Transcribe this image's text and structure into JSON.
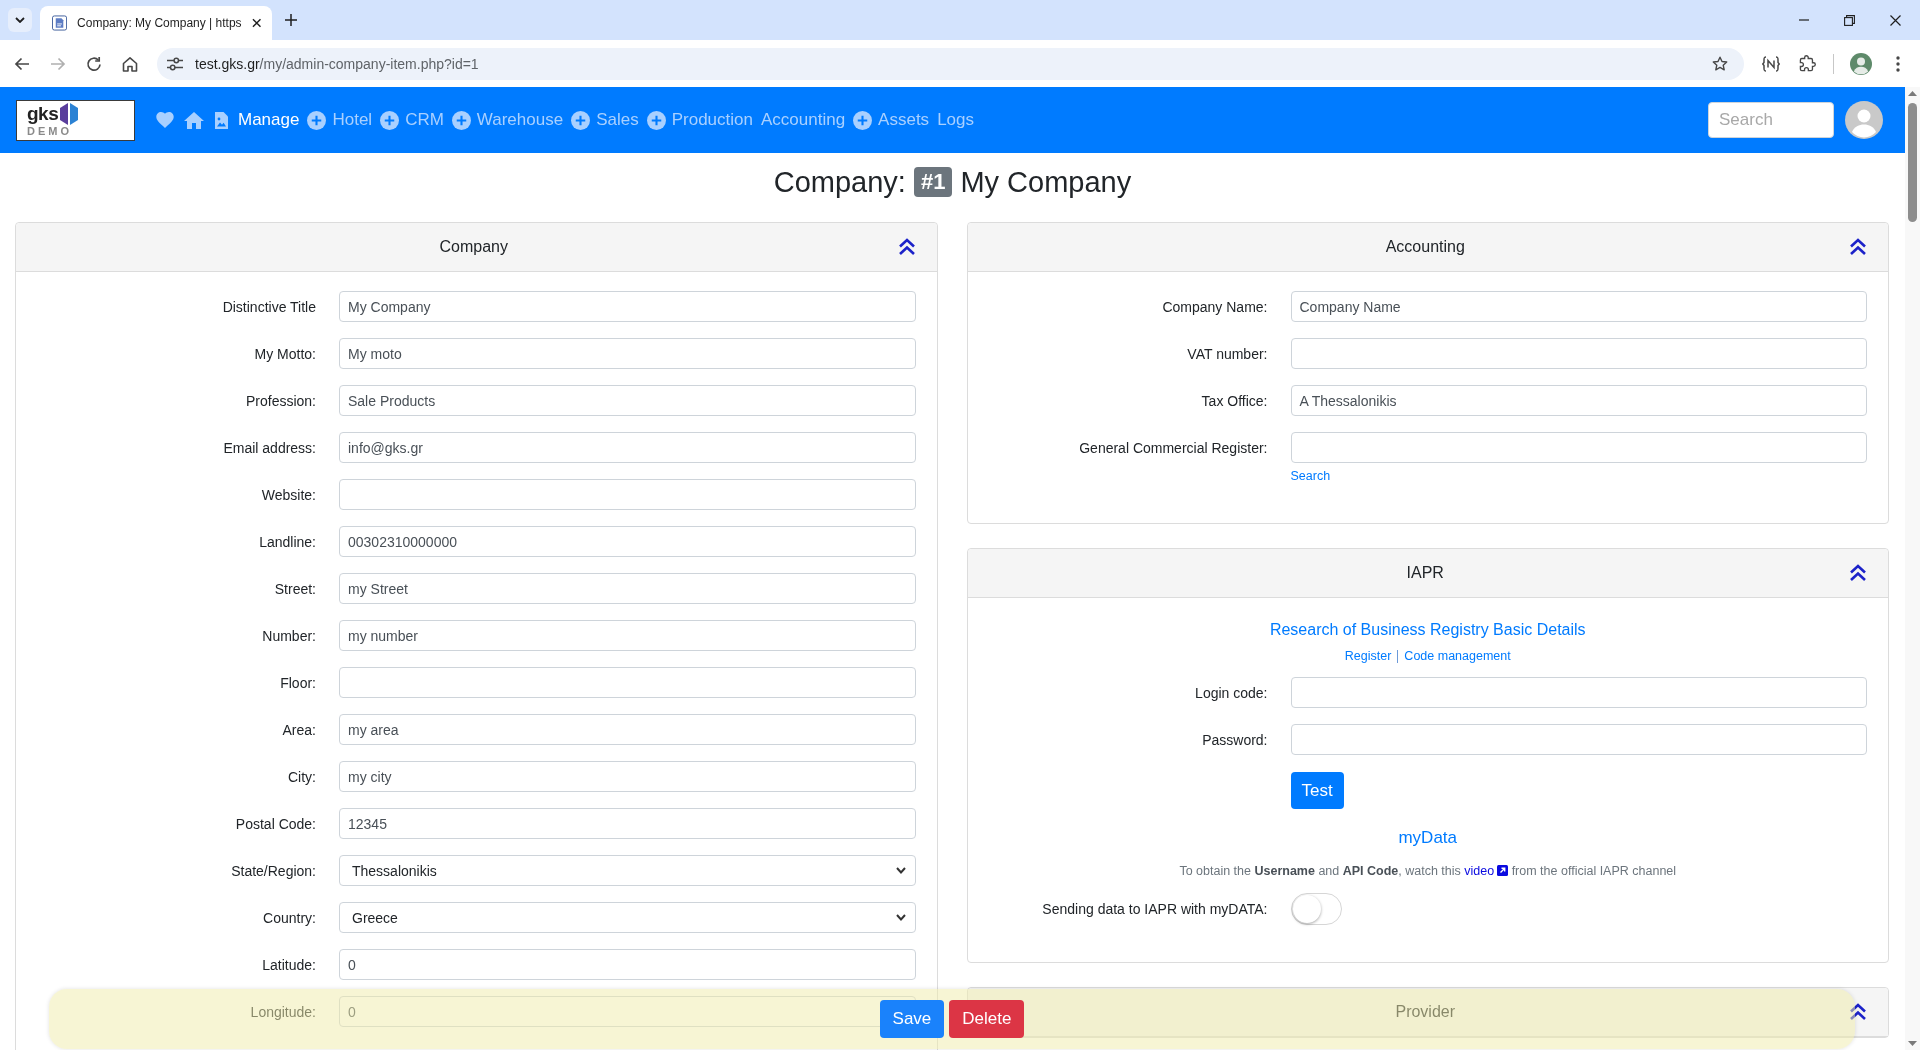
{
  "browser": {
    "tab_title": "Company: My Company | https",
    "url_host": "test.gks.gr",
    "url_path": "/my/admin-company-item.php?id=1"
  },
  "navbar": {
    "logo_text": "gks",
    "logo_stamp": "DEMO",
    "items": [
      {
        "label": "Manage",
        "selected": true,
        "add_button": false
      },
      {
        "label": "Hotel",
        "selected": false,
        "add_button": true
      },
      {
        "label": "CRM",
        "selected": false,
        "add_button": true
      },
      {
        "label": "Warehouse",
        "selected": false,
        "add_button": true
      },
      {
        "label": "Sales",
        "selected": false,
        "add_button": true
      },
      {
        "label": "Production",
        "selected": false,
        "add_button": true
      },
      {
        "label": "Accounting",
        "selected": false,
        "add_button": false
      },
      {
        "label": "Assets",
        "selected": false,
        "add_button": true
      },
      {
        "label": "Logs",
        "selected": false,
        "add_button": false
      }
    ],
    "search": {
      "placeholder": "Search"
    }
  },
  "page_title": {
    "prefix": "Company:",
    "badge": "#1",
    "name": "My Company"
  },
  "company_panel": {
    "title": "Company",
    "expanded": true,
    "fields": [
      {
        "label": "Distinctive Title",
        "value": "My Company",
        "kind": "text"
      },
      {
        "label": "My Motto:",
        "value": "My moto",
        "kind": "text"
      },
      {
        "label": "Profession:",
        "value": "Sale Products",
        "kind": "text"
      },
      {
        "label": "Email address:",
        "value": "info@gks.gr",
        "kind": "text"
      },
      {
        "label": "Website:",
        "kind": "text"
      },
      {
        "label": "Landline:",
        "value": "00302310000000",
        "kind": "text"
      },
      {
        "label": "Street:",
        "value": "my Street",
        "kind": "text"
      },
      {
        "label": "Number:",
        "value": "my number",
        "kind": "text"
      },
      {
        "label": "Floor:",
        "kind": "text"
      },
      {
        "label": "Area:",
        "value": "my area",
        "kind": "text"
      },
      {
        "label": "City:",
        "value": "my city",
        "kind": "text"
      },
      {
        "label": "Postal Code:",
        "value": "12345",
        "kind": "text"
      },
      {
        "label": "State/Region:",
        "value": "Thessalonikis",
        "kind": "select"
      },
      {
        "label": "Country:",
        "value": "Greece",
        "kind": "select"
      },
      {
        "label": "Latitude:",
        "value": "0",
        "kind": "text"
      },
      {
        "label": "Longitude:",
        "value": "0",
        "kind": "text"
      }
    ]
  },
  "accounting_panel": {
    "title": "Accounting",
    "expanded": true,
    "fields": [
      {
        "label": "Company Name:",
        "value": "Company Name"
      },
      {
        "label": "VAT number:"
      },
      {
        "label": "Tax Office:",
        "value": "A Thessalonikis"
      },
      {
        "label": "General Commercial Register:"
      }
    ],
    "search_link": "Search"
  },
  "iapr_panel": {
    "title": "IAPR",
    "expanded": true,
    "heading_link": "Research of Business Registry Basic Details",
    "links": [
      "Register",
      "Code management"
    ],
    "fields": [
      {
        "label": "Login code:"
      },
      {
        "label": "Password:"
      }
    ],
    "test_button": "Test",
    "mydata_link": "myData",
    "note": {
      "before": "To obtain the **Username** and **API Code**, watch this ",
      "link": "video",
      "after": " from the official IAPR channel"
    },
    "toggle": {
      "label": "Sending data to IAPR with myDATA:",
      "on": false
    }
  },
  "provider_panel": {
    "title": "Provider",
    "expanded": true
  },
  "action_bar": {
    "buttons": [
      {
        "label": "Save",
        "kind": "primary"
      },
      {
        "label": "Delete",
        "kind": "danger"
      }
    ]
  }
}
